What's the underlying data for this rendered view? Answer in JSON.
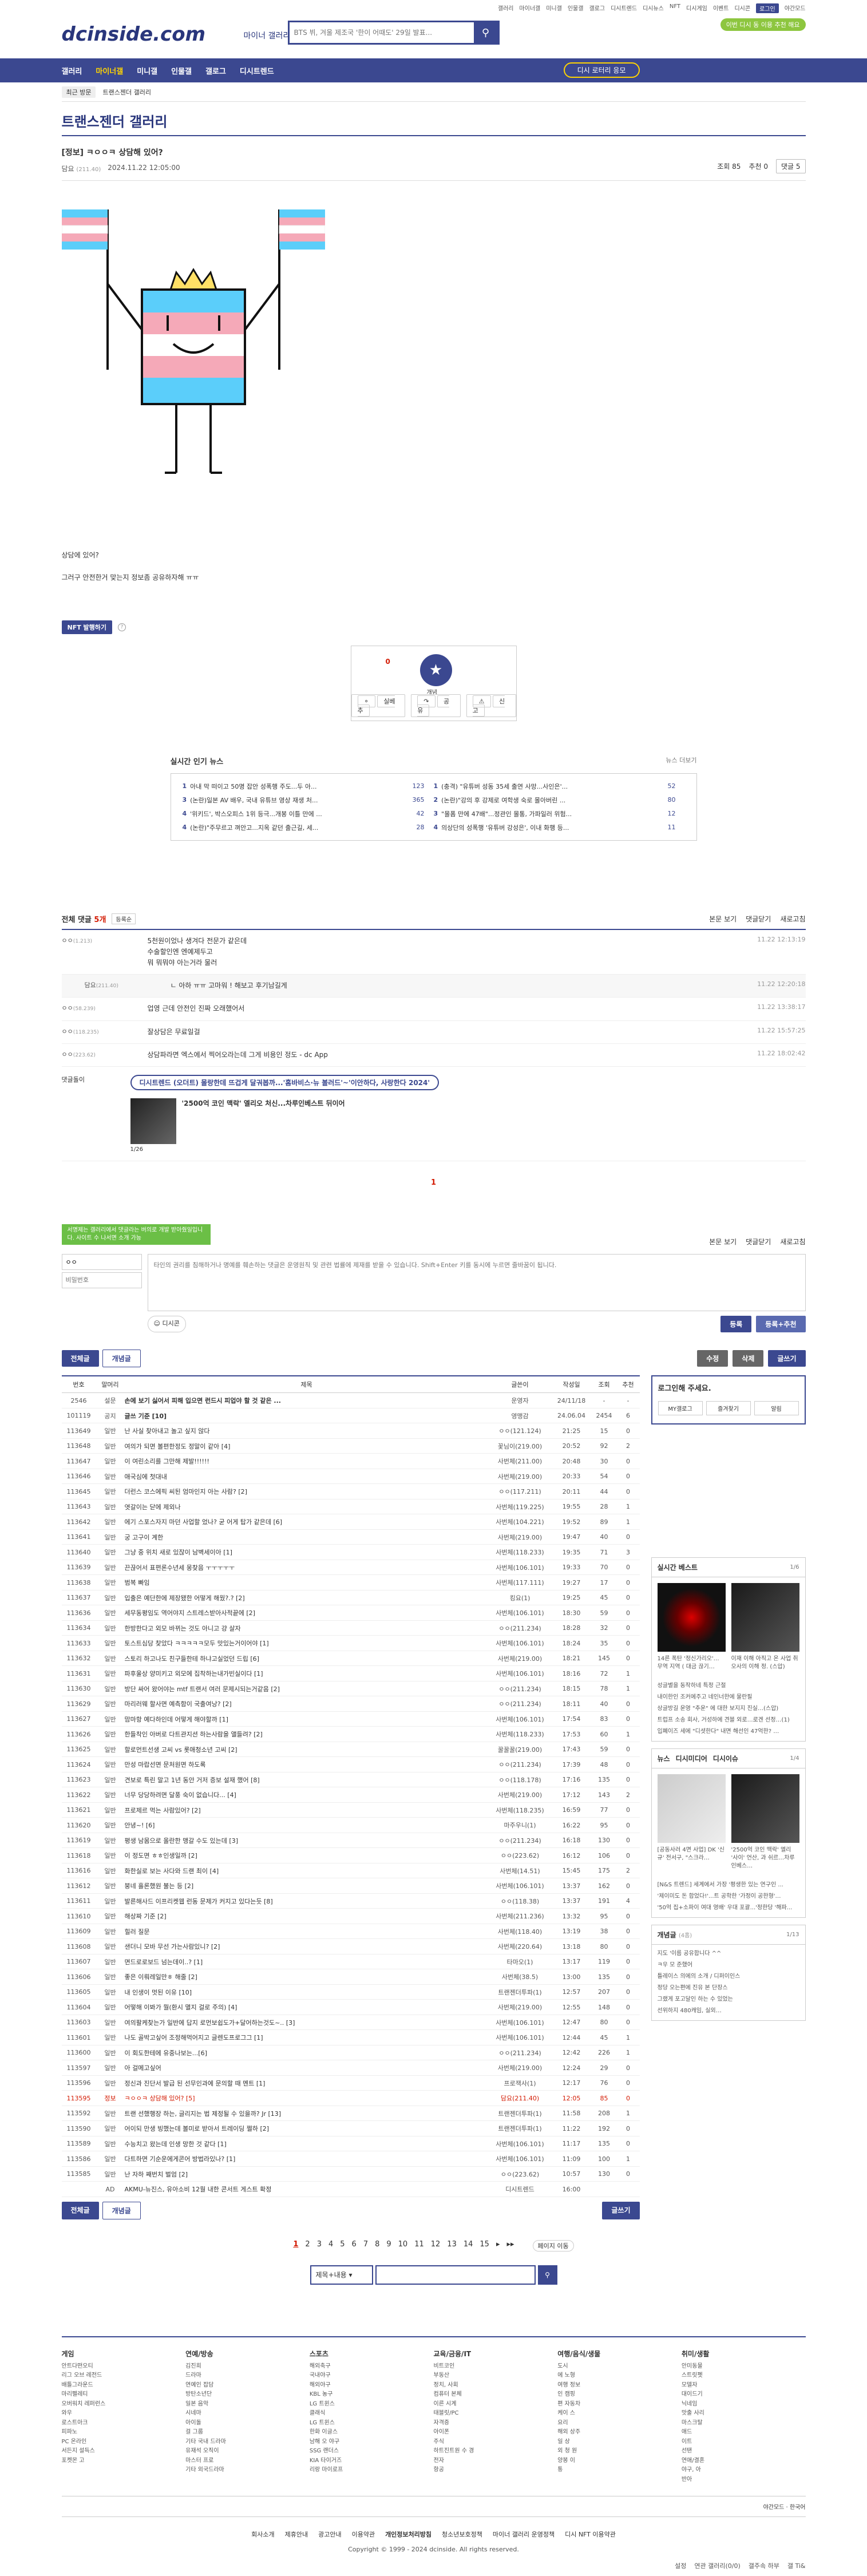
{
  "topbar": {
    "links": [
      "갤러리",
      "마이너갤",
      "미니갤",
      "인물갤",
      "갤로그",
      "디시트렌드",
      "디시뉴스",
      "NFT",
      "디시게임",
      "이벤트",
      "디시콘"
    ],
    "login": "로그인",
    "night": "야간모드"
  },
  "header": {
    "logo": "dcinside.com",
    "logo_sub": "마이너 갤러리",
    "search_placeholder": "BTS 뷔, 겨울 제조국 '한이 어때도' 29일 발표...",
    "badge": "이번 디시 동 이용 추천 해요"
  },
  "gnb": {
    "items": [
      "갤러리",
      "마이너갤",
      "미니갤",
      "인물갤",
      "갤로그",
      "디시트렌드"
    ],
    "dlogin": "디시 로터리 응모"
  },
  "recent": {
    "label": "최근 방문",
    "item": "트랜스젠더 갤러리"
  },
  "gallery": {
    "title": "트랜스젠더 갤러리",
    "right": [
      "설정",
      "연관 갤러리(0/0)",
      "갤주속 하부",
      "갤 Ti&"
    ]
  },
  "post": {
    "title": "[정보] ㅋㅇㅇㅋ 상담해 있어?",
    "author": "담요",
    "author_ip": "(211.40)",
    "date": "2024.11.22 12:05:00",
    "views": "조회 85",
    "recommends": "추천 0",
    "comment_btn": "댓글 5",
    "text1": "상담에 있어?",
    "text2": "그러구 안전한거 맞는지 정보좀 공유하자해 ㅠㅠ"
  },
  "nft": {
    "label": "NFT 발행하기"
  },
  "recommend": {
    "count": "0",
    "label": "개념",
    "b1": "실베추",
    "b2": "공유",
    "b3": "신고"
  },
  "news": {
    "title": "실시간 인기 뉴스",
    "more": "뉴스 더보기",
    "left": [
      {
        "n": "1",
        "t": "아내 막 떠이고 50명 잡안 성폭행 주도...두 아...",
        "c": "123"
      },
      {
        "n": "3",
        "t": "(논란)일본 AV 배우, 국내 유튜브 영상 재생 처...",
        "c": "365"
      },
      {
        "n": "4",
        "t": "'위키드', 박스오피스 1위 등극...개봉 이틀 만에 ...",
        "c": "42"
      },
      {
        "n": "4",
        "t": "(논란)\"주무르고 껴안고...지옥 같던 출근길, 세...",
        "c": "28"
      }
    ],
    "right": [
      {
        "n": "1",
        "t": "(충격) \"유튜버 성동 35세 출연 사망...사인은'...",
        "c": "52"
      },
      {
        "n": "2",
        "t": "(논란)\"강의 후 강제로 여학생 숙로 몰아버린 ...",
        "c": "80"
      },
      {
        "n": "3",
        "t": "\"몰폼 만에 47배\"...정관인 몰통, 가파일러 위험...",
        "c": "12"
      },
      {
        "n": "4",
        "t": "의상단의 성폭행 '유튜버 강성은', 이내 화행 등...",
        "c": "11"
      }
    ]
  },
  "comments": {
    "title": "전체 댓글",
    "count": "5개",
    "sort": "등록순",
    "right": [
      "본문 보기",
      "댓글닫기",
      "새로고침"
    ],
    "rows": [
      {
        "nick": "ㅇㅇ",
        "ip": "(1.213)",
        "text": "5천원이었나 생겨다 전문가 같은데\n수술할인엔 엔예제두고\n뭐 뭐뭐야 아는거라 물러",
        "date": "11.22 12:13:19"
      },
      {
        "nick": "담요",
        "ip": "(211.40)",
        "text": "ㄴ 아하 ㅠㅠ 고마워 ! 해보고 후기남길게",
        "date": "11.22 12:20:18",
        "reply": true
      },
      {
        "nick": "ㅇㅇ",
        "ip": "(58.239)",
        "text": "업영 근데 안전인 진짜 오래했어서",
        "date": "11.22 13:38:17"
      },
      {
        "nick": "ㅇㅇ",
        "ip": "(118.235)",
        "text": "잘상담은 무료일걸",
        "date": "11.22 15:57:25"
      },
      {
        "nick": "ㅇㅇ",
        "ip": "(223.62)",
        "text": "상담파라면 엑스에서 찍어오라는데 그게 비용인 정도 - dc App",
        "date": "11.22 18:02:42"
      }
    ],
    "ad": {
      "tag": "댓글돌이",
      "title": "디시트렌드 (오더트) 몰랑한데 뜨겁게 달궈봅까...'홈바비스·뉴 볼러드'~'이안하다, 사랑한다 2024'",
      "sub": "'2500억 코인 맥락' 엘리오 처신...차루인베스트 뒤이어",
      "page": "1/26"
    }
  },
  "cmt_pager": "1",
  "write": {
    "toast": "서명제는 갤러리에서 댓글라는 버의로 개발 받아줬일입니다. 사이트 수 나서면 소개 가능",
    "nick": "ㅇㅇ",
    "pw": "비밀번호",
    "placeholder": "타인의 권리를 침해하거나 명예를 훼손하는 댓글은 운영원칙 및 관련 법률에 제재를 받을 수 있습니다. Shift+Enter 키를 동시에 누르면 줄바꿈이 됩니다.",
    "dccon": "디시콘",
    "submit": "등록",
    "submit2": "등록+추천"
  },
  "list_tabs": {
    "all": "전체글",
    "concept": "개념글",
    "edit": "수정",
    "delete": "삭제",
    "write": "글쓰기"
  },
  "list": {
    "headers": [
      "번호",
      "말머리",
      "제목",
      "글쓴이",
      "작성일",
      "조회",
      "추천"
    ],
    "rows": [
      [
        "2546",
        "설문",
        "손에 보기 싫어서 피해 입으면 런드시 피업야 할 것 같은 ...",
        "운영자",
        "24/11/18",
        "-",
        "-",
        "notice"
      ],
      [
        "101119",
        "공지",
        "글쓰 기준 [10]",
        "영맹감",
        "24.06.04",
        "2454",
        "6",
        "notice"
      ],
      [
        "113649",
        "일반",
        "난 사실 찾아내고 놀고 싶지 않다",
        "ㅇㅇ(121.124)",
        "21:25",
        "15",
        "0",
        ""
      ],
      [
        "113648",
        "일반",
        "여의가 되면 볼편한정도 정말이 같아 [4]",
        "꽃님이(219.00)",
        "20:52",
        "92",
        "2",
        ""
      ],
      [
        "113647",
        "일반",
        "이 여린소리를 그만해 제발!!!!!!",
        "사번체(211.00)",
        "20:48",
        "30",
        "0",
        ""
      ],
      [
        "113646",
        "일반",
        "애국심에 첫대내",
        "사번체(219.00)",
        "20:33",
        "54",
        "0",
        ""
      ],
      [
        "113645",
        "일반",
        "더런스 코스에픽 씨된 엄마인지 아는 사람? [2]",
        "ㅇㅇ(117.211)",
        "20:11",
        "44",
        "0",
        ""
      ],
      [
        "113643",
        "일반",
        "엿갈이는 닫에 제외나",
        "사번체(119.225)",
        "19:55",
        "28",
        "1",
        ""
      ],
      [
        "113642",
        "일반",
        "에기 스포스자지 마던 사업할 었나? 굳 어게 탑가 같은데 [6]",
        "사번체(104.221)",
        "19:52",
        "89",
        "1",
        ""
      ],
      [
        "113641",
        "일반",
        "궁 고구이 계한",
        "사번체(219.00)",
        "19:47",
        "40",
        "0",
        ""
      ],
      [
        "113640",
        "일반",
        "그냥 중 위치 새로 있잖이 남벽세이아 [1]",
        "사번체(118.233)",
        "19:35",
        "71",
        "3",
        ""
      ],
      [
        "113639",
        "일반",
        "끈끊어서 표편론수년세 몽찾음 ㅜㅜㅜㅜㅜ",
        "사번체(106.101)",
        "19:33",
        "70",
        "0",
        ""
      ],
      [
        "113638",
        "일반",
        "범복 빠임",
        "사번체(117.111)",
        "19:27",
        "17",
        "0",
        ""
      ],
      [
        "113637",
        "일반",
        "입출은 예단한에 제장됐한 어떻게 해웠?.? [2]",
        "킹요(1)",
        "19:25",
        "45",
        "0",
        ""
      ],
      [
        "113636",
        "일반",
        "세무동평임도 역어야지 스트레스받아사적끝에 [2]",
        "사번체(106.101)",
        "18:30",
        "59",
        "0",
        ""
      ],
      [
        "113634",
        "일반",
        "한방한다고 외모 바뀌는 것도 아니고 걍 살자",
        "ㅇㅇ(211.234)",
        "18:28",
        "32",
        "0",
        ""
      ],
      [
        "113633",
        "일반",
        "토스트심당 찾았다 ㅋㅋㅋㅋㅋ모두 맛있는거이어야 [1]",
        "사번체(106.101)",
        "18:24",
        "35",
        "0",
        ""
      ],
      [
        "113632",
        "일반",
        "스토리 하고나도 친구들한테 하냐고실었던 드립 [6]",
        "사번체(219.00)",
        "18:21",
        "145",
        "0",
        ""
      ],
      [
        "113631",
        "일반",
        "파후울상 양미키고 외모에 집착하는내가빈실이다 [1]",
        "사번체(106.101)",
        "18:16",
        "72",
        "1",
        ""
      ],
      [
        "113630",
        "일반",
        "방단 싸어 왔어야는 mtf 트랜서 여러 문제시되는거같음 [2]",
        "ㅇㅇ(211.234)",
        "18:15",
        "78",
        "1",
        ""
      ],
      [
        "113629",
        "일반",
        "마리러웨 할사면 예측함이 국출여낭? [2]",
        "ㅇㅇ(211.234)",
        "18:11",
        "40",
        "0",
        ""
      ],
      [
        "113627",
        "일반",
        "맘마항 예다하인데 어떻게 해야할까 [1]",
        "사번체(106.101)",
        "17:54",
        "83",
        "0",
        ""
      ],
      [
        "113626",
        "일반",
        "한들착인 아버로 다트관지션 하는사람을 앨들려? [2]",
        "사번체(118.233)",
        "17:53",
        "60",
        "1",
        ""
      ],
      [
        "113625",
        "일반",
        "할로먼트선생 고씨 vs 롯애청소년 고씨 [2]",
        "꿀꿀꿀(219.00)",
        "17:43",
        "59",
        "0",
        ""
      ],
      [
        "113624",
        "일반",
        "만성 마랍선면 문처원면 하도록",
        "ㅇㅇ(211.234)",
        "17:39",
        "48",
        "0",
        ""
      ],
      [
        "113623",
        "일반",
        "견보로 특린 말고 1년 동안 거저 증보 설재 했어 [8]",
        "ㅇㅇ(118.178)",
        "17:16",
        "135",
        "0",
        ""
      ],
      [
        "113622",
        "일반",
        "너무 당당하려면 달풍 숙이 없습니다... [4]",
        "사번체(219.00)",
        "17:12",
        "143",
        "2",
        ""
      ],
      [
        "113621",
        "일반",
        "프로제르 먹는 사람있어? [2]",
        "사번체(118.235)",
        "16:59",
        "77",
        "0",
        ""
      ],
      [
        "113620",
        "일반",
        "안녕~! [6]",
        "마주우니(1)",
        "16:22",
        "95",
        "0",
        ""
      ],
      [
        "113619",
        "일반",
        "평생 남몸으로 올란한 맹갈 수도 있는데 [3]",
        "ㅇㅇ(211.234)",
        "16:18",
        "130",
        "0",
        ""
      ],
      [
        "113618",
        "일반",
        "이 정도면 ㅎㅎ인생일까 [2]",
        "ㅇㅇ(223.62)",
        "16:12",
        "106",
        "0",
        ""
      ],
      [
        "113616",
        "일반",
        "화한실로 보는 사다와 드랜 최이 [4]",
        "사번체(14.51)",
        "15:45",
        "175",
        "2",
        ""
      ],
      [
        "113612",
        "일반",
        "붕네 흘론했원 불는 등 [2]",
        "사번체(106.101)",
        "13:37",
        "162",
        "0",
        ""
      ],
      [
        "113611",
        "일반",
        "발른해사드 이프리켓웹 런동 문제가 커지고 있다는듯 [8]",
        "ㅇㅇ(118.38)",
        "13:37",
        "191",
        "4",
        ""
      ],
      [
        "113610",
        "일반",
        "해상짜 기준 [2]",
        "사번체(211.236)",
        "13:32",
        "95",
        "0",
        ""
      ],
      [
        "113609",
        "일반",
        "힐러 질문",
        "사번체(118.40)",
        "13:19",
        "38",
        "0",
        ""
      ],
      [
        "113608",
        "일반",
        "샌더니 모바 무선 가는사람있니? [2]",
        "사번체(220.64)",
        "13:18",
        "80",
        "0",
        ""
      ],
      [
        "113607",
        "일반",
        "면드로로보드 넘는데이..? [1]",
        "타마오(1)",
        "13:17",
        "119",
        "0",
        ""
      ],
      [
        "113606",
        "일반",
        "좋은 이뤄레일만ㅎ 해줄 [2]",
        "사번체(38.5)",
        "13:00",
        "135",
        "0",
        ""
      ],
      [
        "113605",
        "일반",
        "내 인생이 멋된 이유 [10]",
        "트랜젠더투파(1)",
        "12:57",
        "207",
        "0",
        ""
      ],
      [
        "113604",
        "일반",
        "어떻해 이봐가 뭘(환시 멸지 걸로 주의) [4]",
        "사번체(219.00)",
        "12:55",
        "148",
        "0",
        ""
      ],
      [
        "113603",
        "일반",
        "여의팔케찾는가 일반에 답지 로먼보쉽도가+달어하는것도~.. [3]",
        "사번체(106.101)",
        "12:47",
        "80",
        "0",
        ""
      ],
      [
        "113601",
        "일반",
        "나도 골박고싶어 조정해먹어지고 글렌도프로그그 [1]",
        "사번체(106.101)",
        "12:44",
        "45",
        "1",
        ""
      ],
      [
        "113600",
        "일반",
        "이 회도한테에 유중나보는...[6]",
        "ㅇㅇ(211.234)",
        "12:42",
        "226",
        "1",
        ""
      ],
      [
        "113597",
        "일반",
        "아 걸메고싶어",
        "사번체(219.00)",
        "12:24",
        "29",
        "0",
        ""
      ],
      [
        "113596",
        "일반",
        "정신과 진단서 발급 된 선무인과에 문의할 때 멘트 [1]",
        "프로잭사(1)",
        "12:17",
        "76",
        "0",
        ""
      ],
      [
        "113595",
        "정보",
        "ㅋㅇㅇㅋ 상담해 있어? [5]",
        "담요(211.40)",
        "12:05",
        "85",
        "0",
        "cur"
      ],
      [
        "113592",
        "일반",
        "트랜 선했행장 하는, 글리지는 법 제정될 수 있을까? Jr [13]",
        "트랜젠더투파(1)",
        "11:58",
        "208",
        "1",
        ""
      ],
      [
        "113590",
        "일반",
        "어이되 만생 빙했는데 볼미로 받아서 트레이딩 쩔하 [2]",
        "트랜젠더투파(1)",
        "11:22",
        "192",
        "0",
        ""
      ],
      [
        "113589",
        "일반",
        "수능치고 왔는데 인생 망한 것 같다 [1]",
        "사번체(106.101)",
        "11:17",
        "135",
        "0",
        ""
      ],
      [
        "113586",
        "일반",
        "다트하면 기순운에게콘어 방법라있나? [1]",
        "사번체(106.101)",
        "11:09",
        "100",
        "1",
        ""
      ],
      [
        "113585",
        "일반",
        "난 자하 째번치 벌엄 [2]",
        "ㅇㅇ(223.62)",
        "10:57",
        "130",
        "0",
        ""
      ],
      [
        "",
        "AD",
        "AKMU-뉴진스, 유아소비 12월 내한 콘서트 게스트 확정",
        "디시트렌드",
        "16:00",
        "",
        "",
        "ad"
      ]
    ]
  },
  "sidebar": {
    "login_msg": "로그인해 주세요.",
    "tabs": [
      "MY갤로그",
      "즐겨찾기",
      "알림"
    ],
    "best": {
      "title": "실시간 베스트",
      "page": "1/6",
      "items": [
        {
          "t": "14른 폭탄 '정신가리오'… 무역 지역 ( 대금 끊기…"
        },
        {
          "t": "이재 이해 아직고 온 사업 취 오사의 이해 정. (스압)"
        }
      ],
      "list": [
        "성글별을 동작하네 특정 근절",
        "내이한인 조커에주고 네인너한에 물란필",
        "상글방길 운영 \"추운\" 에 대한 보지지 진실…(스압)",
        "트럽프 소송 회사, 거성하에 견블 외로…로겐 선정…(1)",
        "입폐이즈 세에 \"디셧한다\" 내면 해선인 47억한? …"
      ]
    },
    "news": {
      "tabs": [
        "뉴스",
        "디시미디어",
        "디시이슈"
      ],
      "page": "1/4",
      "items": [
        {
          "t": "[공동사러 4면 사업] DK '신규' 전서구, \"스크라…"
        },
        {
          "t": "'2500억 코인 맥락' 엘리 '사이' 언산, 과 쉬르…차루인베스…"
        }
      ],
      "list": [
        "[N&S 트렌드] 세계에서 가장 '평생한 있는 연구인 ...",
        "'제이미도 돈 합었다!'...트 공학한 '가정이 공한형'…",
        "'50억 집+소파이 여대 영배' 우대 포괄...'정한당 '해파..."
      ]
    },
    "concept": {
      "title": "개념글",
      "sub": "(4홉)",
      "page": "1/13",
      "list": [
        "지도 '이름 공유합니다 ^^",
        "ㅋ우 모 준했어",
        "틀레이스 의에의 소개 / 디퍼이인스",
        "정당 오는편에 진유 본 단장스",
        "그랬게 포고달인 하는 수 있었는",
        "선위하지 480캐임, 실외…"
      ]
    }
  },
  "list_bottom": {
    "all": "전체글",
    "concept": "개념글",
    "write": "글쓰기"
  },
  "pager": {
    "pages": [
      "1",
      "2",
      "3",
      "4",
      "5",
      "6",
      "7",
      "8",
      "9",
      "10",
      "11",
      "12",
      "13",
      "14",
      "15"
    ],
    "move": "페이지 이동"
  },
  "search_bottom": {
    "select": "제목+내용"
  },
  "footer": {
    "cols": [
      {
        "h": "게임",
        "items": [
          "안트다떤오티",
          "리그 오브 레전드",
          "배틀그라운드",
          "마리펠레티",
          "오버워치 레퍼런스",
          "와우",
          "로스트아크",
          "피파노",
          "PC 온라인",
          "서든지 설득스",
          "포켓몬 고"
        ]
      },
      {
        "h": "연예/방송",
        "items": [
          "김진희",
          "드라마",
          "연예인 잡담",
          "방탄소년단",
          "일본 음악",
          "시네마",
          "아이돌",
          "걸 그룹",
          "기타 국내 드라마",
          "유재석 오직이",
          "마스터 프로",
          "기타 외국드라마"
        ]
      },
      {
        "h": "스포츠",
        "items": [
          "해외축구",
          "국내야구",
          "해외야구",
          "KBL 농구",
          "LG 트윈스",
          "클래식",
          "LG 트윈스",
          "한화 이글스",
          "남해 오 야구",
          "SSG 랜더스",
          "KIA 타이거즈",
          "리랑 마이로프"
        ]
      },
      {
        "h": "교육/금융/IT",
        "items": [
          "비트코인",
          "부동산",
          "정치, 사회",
          "컴퓨터 본체",
          "이른 시계",
          "태블릿/PC",
          "자격증",
          "아이폰",
          "주식",
          "하트진트원 수 경",
          "전자",
          "항공"
        ]
      },
      {
        "h": "여행/음식/생물",
        "items": [
          "도시",
          "에 노형",
          "여행 정보",
          "인 캠핑",
          "편 자동차",
          "케이 스",
          "요리",
          "해외 상주",
          "일 상",
          "외 청 원",
          "양봉 이",
          "통"
        ]
      },
      {
        "h": "취미/생활",
        "items": [
          "안미동물",
          "스트릿펫",
          "모델자",
          "대이드기",
          "닉네임",
          "맛출 사리",
          "마스크탈",
          "애드",
          "이트",
          "선탠",
          "연애/결혼",
          "야구, 아",
          "반아"
        ]
      }
    ],
    "lang": "야간모드 · 한국어",
    "links": [
      "회사소개",
      "제휴안내",
      "광고안내",
      "이용약관",
      "개인정보처리방침",
      "청소년보호정책",
      "마이너 갤러리 운영정책",
      "디시 NFT 이용약관"
    ],
    "copyright": "Copyright © 1999 - 2024 dcinside. All rights reserved."
  }
}
